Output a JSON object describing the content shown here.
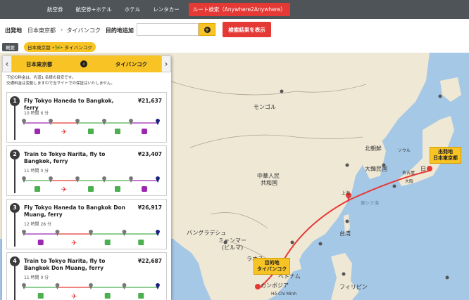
{
  "top_nav": {
    "items": [
      "航空券",
      "航空券+ホテル",
      "ホテル",
      "レンタカー",
      "ルート検索（Anywhere2Anywhere）"
    ],
    "active_index": 4
  },
  "search": {
    "departure_label": "出発地",
    "departure_value": "日本東京都",
    "destination_value": "タイバンコク",
    "add_destination_label": "目的地追加",
    "add_destination_input_value": "",
    "search_button_label": "検索結果を表示"
  },
  "overview": {
    "label": "概要",
    "route_from": "日本東京都",
    "route_to": "タイバンコク",
    "route_separator": "•🛩•"
  },
  "panel": {
    "route_from": "日本東京都",
    "route_to": "タイバンコク",
    "note_line1": "下記の料金は、片道1 名様の目安です。",
    "note_line2": "交通料金は変動しますので当サイトでの保証はいたしません。",
    "options": [
      {
        "num": "1",
        "title": "Fly Tokyo Haneda to Bangkok, ferry",
        "price": "¥21,637",
        "duration": "10 時間 6 分",
        "legs": [
          "train",
          "plane",
          "bus",
          "bus",
          "train"
        ]
      },
      {
        "num": "2",
        "title": "Train to Tokyo Narita, fly to Bangkok, ferry",
        "price": "¥23,407",
        "duration": "11 時間 0 分",
        "legs": [
          "bus",
          "plane",
          "bus",
          "bus",
          "train"
        ]
      },
      {
        "num": "3",
        "title": "Fly Tokyo Haneda to Bangkok Don Muang, ferry",
        "price": "¥26,917",
        "duration": "12 時間 28 分",
        "legs": [
          "train",
          "plane",
          "bus",
          "bus"
        ]
      },
      {
        "num": "4",
        "title": "Train to Tokyo Narita, fly to Bangkok Don Muang, ferry",
        "price": "¥22,687",
        "duration": "11 時間 0 分",
        "legs": [
          "bus",
          "plane",
          "bus",
          "bus"
        ]
      }
    ]
  },
  "map": {
    "labels": {
      "mongolia": "モンゴル",
      "north_korea": "北朝鮮",
      "seoul": "ソウル",
      "korea": "大韓民国",
      "china_1": "中華人民",
      "china_2": "共和国",
      "taiwan": "台湾",
      "bangladesh": "バングラデシュ",
      "myanmar_1": "ミャンマー",
      "myanmar_2": "(ビルマ)",
      "laos": "ラオス",
      "vietnam": "ベトナム",
      "cambodia": "カンボジア",
      "philippines": "フィリピン",
      "east_china_sea": "東シナ海",
      "osaka": "大阪",
      "nagoya": "名古屋",
      "shanghai": "上海",
      "hochiminh": "Hồ Chí Minh",
      "bangkok_small": "バンコク",
      "japan_partial": "日"
    },
    "origin_callout": {
      "line1": "出発地",
      "line2": "日本東京都"
    },
    "destination_callout": {
      "line1": "目的地",
      "line2": "タイバンコク"
    },
    "colors": {
      "sea": "#a5c8e6",
      "land": "#efe8d5",
      "route": "#e53935",
      "callout": "#f7c325"
    }
  },
  "leg_colors": {
    "train": "#9c27b0",
    "plane": "#e53935",
    "bus": "#4caf50",
    "ferry": "#1a237e"
  }
}
